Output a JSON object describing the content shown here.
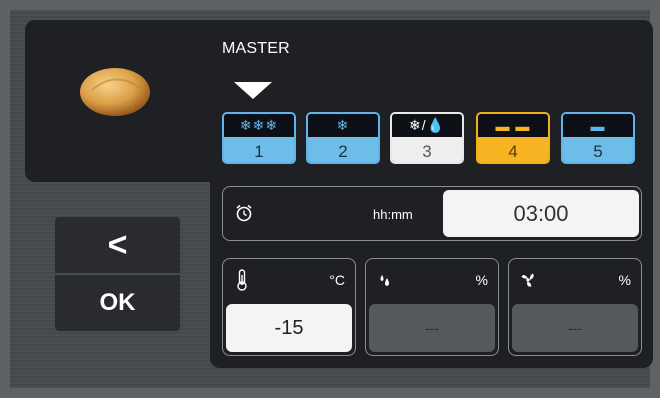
{
  "program": {
    "name": "MASTER",
    "image": "bread-roll"
  },
  "phases": [
    {
      "icon": "deep-freeze-icon",
      "glyph": "❄❄❄",
      "number": "1",
      "style": "blue"
    },
    {
      "icon": "freeze-icon",
      "glyph": "❄",
      "number": "2",
      "style": "blue"
    },
    {
      "icon": "freeze-thaw-icon",
      "glyph": "❄/💧",
      "number": "3",
      "style": "white"
    },
    {
      "icon": "proof-icon",
      "glyph": "▬ ▬",
      "number": "4",
      "style": "orange"
    },
    {
      "icon": "bake-icon",
      "glyph": "▬",
      "number": "5",
      "style": "blue"
    }
  ],
  "navigation": {
    "back_label": "<",
    "ok_label": "OK"
  },
  "timer": {
    "unit": "hh:mm",
    "value": "03:00",
    "icon": "alarm-clock-icon"
  },
  "parameters": {
    "temperature": {
      "icon": "thermometer-icon",
      "unit": "°C",
      "value": "-15"
    },
    "humidity": {
      "icon": "humidity-icon",
      "unit": "%",
      "value": "---"
    },
    "fan": {
      "icon": "fan-icon",
      "unit": "%",
      "value": "---"
    }
  },
  "colors": {
    "accent_blue": "#6dbde8",
    "active_orange": "#f7b321",
    "panel": "#1f2023"
  }
}
